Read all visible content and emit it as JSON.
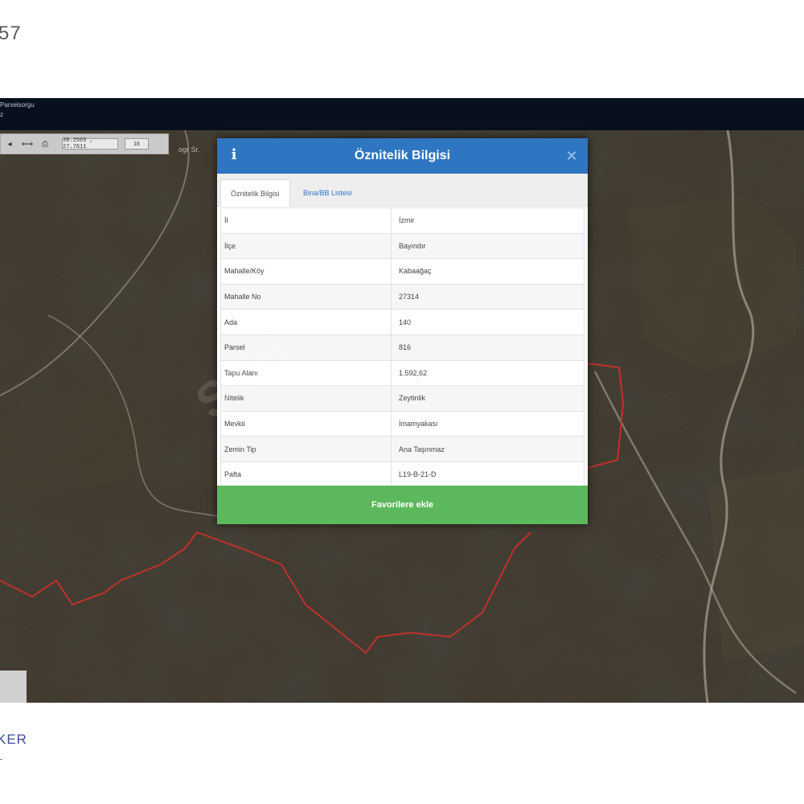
{
  "page": {
    "top_number": "57",
    "footer_brand": "KER",
    "footer_sub": "L"
  },
  "app_header": {
    "title": "Parselsorgu",
    "subtitle": "z"
  },
  "map": {
    "road_label": "ogr Sr.",
    "watermark": "Sahi",
    "toolbar": {
      "coords": "38.2565 , 27.7611",
      "zoom": "16"
    }
  },
  "modal": {
    "title": "Öznitelik Bilgisi",
    "tabs": [
      {
        "label": "Öznitelik Bilgisi",
        "active": true
      },
      {
        "label": "Bina/BB Listesi",
        "active": false
      }
    ],
    "rows": [
      {
        "key": "İl",
        "value": "İzmir"
      },
      {
        "key": "İlçe",
        "value": "Bayındır"
      },
      {
        "key": "Mahalle/Köy",
        "value": "Kabaağaç"
      },
      {
        "key": "Mahalle No",
        "value": "27314"
      },
      {
        "key": "Ada",
        "value": "140"
      },
      {
        "key": "Parsel",
        "value": "816"
      },
      {
        "key": "Tapu Alanı",
        "value": "1.592,62"
      },
      {
        "key": "Nitelik",
        "value": "Zeytinlik"
      },
      {
        "key": "Mevkii",
        "value": "İmamyakası"
      },
      {
        "key": "Zemin Tip",
        "value": "Ana Taşınmaz"
      },
      {
        "key": "Pafta",
        "value": "L19-B-21-D"
      }
    ],
    "favorite_button": "Favorilere ekle"
  },
  "colors": {
    "header_blue": "#2f76c2",
    "button_green": "#5cb85c",
    "app_bar": "#07101c",
    "parcel_border": "#c0312b"
  }
}
